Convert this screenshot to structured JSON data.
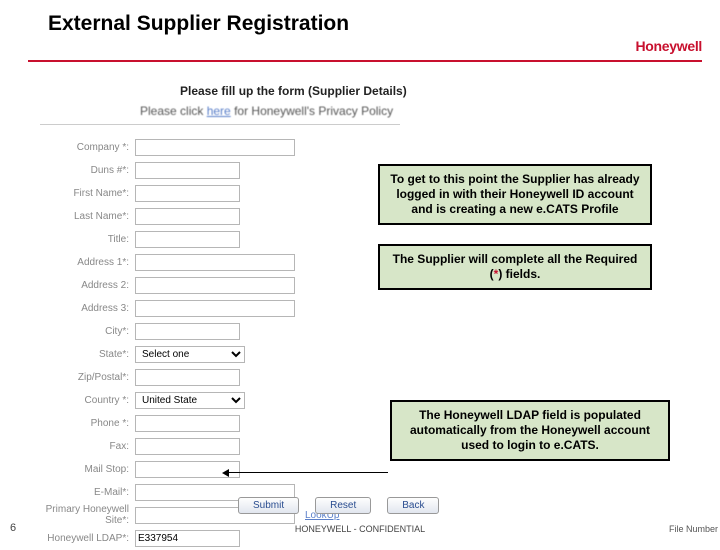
{
  "slide": {
    "title": "External Supplier Registration",
    "brand": "Honeywell",
    "page_number": "6",
    "footer_center": "HONEYWELL - CONFIDENTIAL",
    "footer_right": "File Number"
  },
  "form": {
    "heading": "Please fill up the form (Supplier Details)",
    "privacy_prefix": "Please click ",
    "privacy_link": "here",
    "privacy_suffix": " for Honeywell's Privacy Policy",
    "lookup": "LookUp",
    "fields": {
      "company": "Company *:",
      "duns": "Duns #*:",
      "first_name": "First Name*:",
      "last_name": "Last Name*:",
      "title": "Title:",
      "address1": "Address 1*:",
      "address2": "Address 2:",
      "address3": "Address 3:",
      "city": "City*:",
      "state": "State*:",
      "zip": "Zip/Postal*:",
      "country": "Country *:",
      "phone": "Phone *:",
      "fax": "Fax:",
      "mailstop": "Mail Stop:",
      "email": "E-Mail*:",
      "primary_site": "Primary Honeywell Site*:",
      "ldap": "Honeywell LDAP*:"
    },
    "state_placeholder": "Select one",
    "country_placeholder": "United State",
    "ldap_value": "E337954"
  },
  "callouts": {
    "c1": "To get to this point the Supplier has already logged in with their Honeywell ID account and is creating a new e.CATS Profile",
    "c2_pre": "The Supplier will complete all the Required (",
    "c2_post": ") fields.",
    "c3": "The Honeywell LDAP field is populated automatically from the Honeywell account used to login to e.CATS."
  },
  "buttons": {
    "submit": "Submit",
    "reset": "Reset",
    "back": "Back"
  }
}
